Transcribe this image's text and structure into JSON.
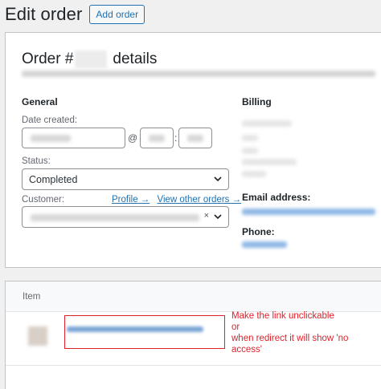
{
  "header": {
    "title": "Edit order",
    "add_button": "Add order"
  },
  "order": {
    "heading_prefix": "Order #",
    "heading_suffix": "details",
    "general_title": "General",
    "date_label": "Date created:",
    "at_symbol": "@",
    "time_sep": ":",
    "status_label": "Status:",
    "status_value": "Completed",
    "customer_label": "Customer:",
    "profile_link": "Profile →",
    "other_orders_link": "View other orders →",
    "customer_clear": "×",
    "billing_title": "Billing",
    "email_label": "Email address:",
    "phone_label": "Phone:"
  },
  "items": {
    "column_label": "Item"
  },
  "annotation": {
    "line1": "Make the link unclickable",
    "line2": "or",
    "line3": "when redirect it will show 'no",
    "line4": "access'",
    "color": "#e0202a"
  },
  "colors": {
    "accent": "#2271b1",
    "panel_border": "#c3c4c7",
    "background": "#f0f0f1"
  },
  "icons": {
    "dropdown": "chevron-down-icon"
  }
}
